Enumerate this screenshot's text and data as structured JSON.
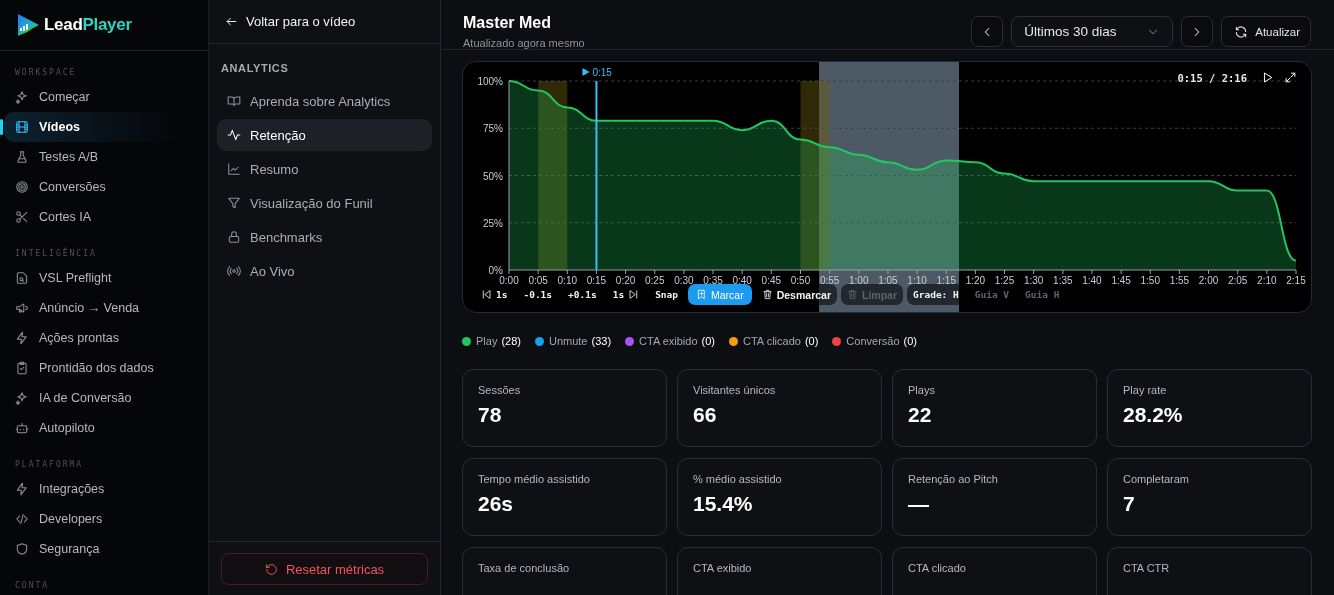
{
  "brand": {
    "first": "Lead",
    "second": "Player"
  },
  "sidebar": {
    "sections": [
      {
        "title": "WORKSPACE",
        "items": [
          {
            "label": "Começar",
            "selected": false
          },
          {
            "label": "Vídeos",
            "selected": true
          },
          {
            "label": "Testes A/B",
            "selected": false
          },
          {
            "label": "Conversões",
            "selected": false
          },
          {
            "label": "Cortes IA",
            "selected": false
          }
        ]
      },
      {
        "title": "INTELIGÊNCIA",
        "items": [
          {
            "label": "VSL Preflight",
            "selected": false
          },
          {
            "label": "Anúncio → Venda",
            "selected": false
          },
          {
            "label": "Ações prontas",
            "selected": false
          },
          {
            "label": "Prontidão dos dados",
            "selected": false
          },
          {
            "label": "IA de Conversão",
            "selected": false
          },
          {
            "label": "Autopiloto",
            "selected": false
          }
        ]
      },
      {
        "title": "PLATAFORMA",
        "items": [
          {
            "label": "Integrações",
            "selected": false
          },
          {
            "label": "Developers",
            "selected": false
          },
          {
            "label": "Segurança",
            "selected": false
          }
        ]
      },
      {
        "title": "CONTA"
      }
    ]
  },
  "subnav": {
    "back": "Voltar para o vídeo",
    "title": "ANALYTICS",
    "items": [
      {
        "label": "Aprenda sobre Analytics",
        "selected": false
      },
      {
        "label": "Retenção",
        "selected": true
      },
      {
        "label": "Resumo",
        "selected": false
      },
      {
        "label": "Visualização do Funil",
        "selected": false
      },
      {
        "label": "Benchmarks",
        "selected": false
      },
      {
        "label": "Ao Vivo",
        "selected": false
      }
    ],
    "reset_button": "Resetar métricas"
  },
  "header": {
    "title": "Master Med",
    "subtitle": "Atualizado agora mesmo",
    "range": "Últimos 30 dias",
    "refresh": "Atualizar"
  },
  "player": {
    "time": "0:15 / 2:16",
    "chart_data": {
      "type": "area",
      "x": [
        0,
        5,
        10,
        15,
        20,
        25,
        30,
        35,
        40,
        45,
        50,
        55,
        60,
        65,
        70,
        75,
        80,
        85,
        90,
        95,
        100,
        105,
        110,
        115,
        120,
        125,
        130,
        135
      ],
      "grid": true,
      "series": [
        {
          "color": "#22c55e",
          "values": [
            100,
            95,
            86,
            79,
            79,
            79,
            79,
            79,
            74,
            79,
            69,
            65,
            61,
            57,
            53,
            58,
            57,
            51,
            47,
            47,
            47,
            47,
            47,
            47,
            47,
            42,
            42,
            5
          ]
        }
      ],
      "ylim": [
        0,
        100
      ],
      "yticks": [
        {
          "value": 0,
          "label": "0%"
        },
        {
          "value": 25,
          "label": "25%"
        },
        {
          "value": 50,
          "label": "50%"
        },
        {
          "value": 75,
          "label": "75%"
        },
        {
          "value": 100,
          "label": "100%"
        }
      ],
      "xlim": [
        0,
        135
      ],
      "xticks": [
        {
          "value": 0,
          "label": "0:00"
        },
        {
          "value": 5,
          "label": "0:05"
        },
        {
          "value": 10,
          "label": "0:10"
        },
        {
          "value": 15,
          "label": "0:15"
        },
        {
          "value": 20,
          "label": "0:20"
        },
        {
          "value": 25,
          "label": "0:25"
        },
        {
          "value": 30,
          "label": "0:30"
        },
        {
          "value": 35,
          "label": "0:35"
        },
        {
          "value": 40,
          "label": "0:40"
        },
        {
          "value": 45,
          "label": "0:45"
        },
        {
          "value": 50,
          "label": "0:50"
        },
        {
          "value": 55,
          "label": "0:55"
        },
        {
          "value": 60,
          "label": "1:00"
        },
        {
          "value": 65,
          "label": "1:05"
        },
        {
          "value": 70,
          "label": "1:10"
        },
        {
          "value": 75,
          "label": "1:15"
        },
        {
          "value": 80,
          "label": "1:20"
        },
        {
          "value": 85,
          "label": "1:25"
        },
        {
          "value": 90,
          "label": "1:30"
        },
        {
          "value": 95,
          "label": "1:35"
        },
        {
          "value": 100,
          "label": "1:40"
        },
        {
          "value": 105,
          "label": "1:45"
        },
        {
          "value": 110,
          "label": "1:50"
        },
        {
          "value": 115,
          "label": "1:55"
        },
        {
          "value": 120,
          "label": "2:00"
        },
        {
          "value": 125,
          "label": "2:05"
        },
        {
          "value": 130,
          "label": "2:10"
        },
        {
          "value": 135,
          "label": "2:15"
        }
      ],
      "bands": [
        {
          "axis": "x",
          "from": 5,
          "to": 10
        },
        {
          "axis": "x",
          "from": 50,
          "to": 55
        }
      ],
      "ref_lines": [
        {
          "axis": "x",
          "value": 15,
          "label": "0:15"
        }
      ]
    },
    "controls": [
      {
        "label": "1s",
        "kind": "step-back"
      },
      {
        "label": "-0.1s",
        "kind": "step"
      },
      {
        "label": "+0.1s",
        "kind": "step"
      },
      {
        "label": "1s",
        "kind": "step-forward"
      },
      {
        "label": "Snap",
        "kind": "toggle",
        "on": true
      },
      {
        "label": "Marcar",
        "kind": "primary"
      },
      {
        "label": "Desmarcar",
        "kind": "action",
        "disabled": false
      },
      {
        "label": "Limpar",
        "kind": "action",
        "disabled": true
      },
      {
        "label": "Grade: H",
        "kind": "toggle",
        "on": true
      },
      {
        "label": "Guia V",
        "kind": "toggle",
        "on": false
      },
      {
        "label": "Guia H",
        "kind": "toggle",
        "on": false
      }
    ]
  },
  "legend": [
    {
      "label": "Play",
      "count": "(28)",
      "color": "#22c55e"
    },
    {
      "label": "Unmute",
      "count": "(33)",
      "color": "#0ea5e9"
    },
    {
      "label": "CTA exibido",
      "count": "(0)",
      "color": "#a855f7"
    },
    {
      "label": "CTA clicado",
      "count": "(0)",
      "color": "#f59e0b"
    },
    {
      "label": "Conversão",
      "count": "(0)",
      "color": "#ef4444"
    }
  ],
  "metrics": [
    {
      "label": "Sessões",
      "value": "78"
    },
    {
      "label": "Visitantes únicos",
      "value": "66"
    },
    {
      "label": "Plays",
      "value": "22"
    },
    {
      "label": "Play rate",
      "value": "28.2%"
    },
    {
      "label": "Tempo médio assistido",
      "value": "26s"
    },
    {
      "label": "% médio assistido",
      "value": "15.4%"
    },
    {
      "label": "Retenção ao Pitch",
      "value": "—"
    },
    {
      "label": "Completaram",
      "value": "7"
    },
    {
      "label": "Taxa de conclusão"
    },
    {
      "label": "CTA exibido"
    },
    {
      "label": "CTA clicado"
    },
    {
      "label": "CTA CTR"
    }
  ]
}
